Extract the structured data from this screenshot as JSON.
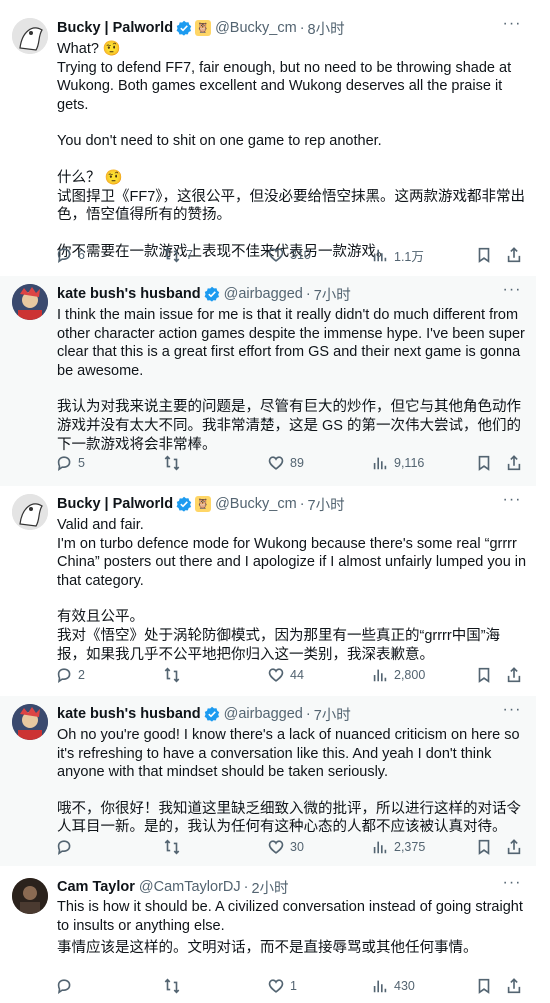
{
  "tweets": [
    {
      "name": "Bucky | Palworld",
      "handle": "@Bucky_cm",
      "time": "8小时",
      "lines": [
        "What? 🤨",
        "Trying to defend FF7, fair enough, but no need to be throwing shade at Wukong. Both games excellent and Wukong deserves all the praise it gets.",
        "",
        "You don't need to shit on one game to rep another.",
        "",
        "什么？ 🤨",
        "试图捍卫《FF7》，这很公平，但没必要给悟空抹黑。这两款游戏都非常出色，悟空值得所有的赞扬。",
        "",
        "你不需要在一款游戏上表现不佳来代表另一款游戏。"
      ],
      "replies": "6",
      "reposts": "7",
      "likes": "310",
      "views": "1.1万"
    },
    {
      "name": "kate bush's husband",
      "handle": "@airbagged",
      "time": "7小时",
      "lines": [
        "I think the main issue for me is that it really didn't do much different from other character action games despite the immense hype.  I've been super clear that this is a great first effort from GS and their next game is gonna be awesome.",
        "",
        "我认为对我来说主要的问题是，尽管有巨大的炒作，但它与其他角色动作游戏并没有太大不同。我非常清楚，这是 GS 的第一次伟大尝试，他们的下一款游戏将会非常棒。"
      ],
      "replies": "5",
      "reposts": "",
      "likes": "89",
      "views": "9,116"
    },
    {
      "name": "Bucky | Palworld",
      "handle": "@Bucky_cm",
      "time": "7小时",
      "lines": [
        "Valid and fair.",
        "I'm on turbo defence mode for Wukong because there's some real “grrrr China” posters out there and I apologize if I almost unfairly lumped you in that category.",
        "",
        "有效且公平。",
        "我对《悟空》处于涡轮防御模式，因为那里有一些真正的“grrrr中国”海报，如果我几乎不公平地把你归入这一类别，我深表歉意。"
      ],
      "replies": "2",
      "reposts": "",
      "likes": "44",
      "views": "2,800"
    },
    {
      "name": "kate bush's husband",
      "handle": "@airbagged",
      "time": "7小时",
      "lines": [
        "Oh no you're good! I know there's a lack of nuanced criticism on here so it's refreshing to have a conversation like this.  And yeah I don't think anyone with that mindset should be taken seriously.",
        "",
        "哦不，你很好！我知道这里缺乏细致入微的批评，所以进行这样的对话令人耳目一新。是的，我认为任何有这种心态的人都不应该被认真对待。"
      ],
      "replies": "",
      "reposts": "",
      "likes": "30",
      "views": "2,375"
    },
    {
      "name": "Cam Taylor",
      "handle": "@CamTaylorDJ",
      "time": "2小时",
      "lines": [
        "This is how it should be. A civilized conversation instead of going straight to insults or anything else.",
        "",
        "事情应该是这样的。文明对话，而不是直接辱骂或其他任何事情。"
      ],
      "replies": "",
      "reposts": "",
      "likes": "1",
      "views": "430"
    }
  ]
}
